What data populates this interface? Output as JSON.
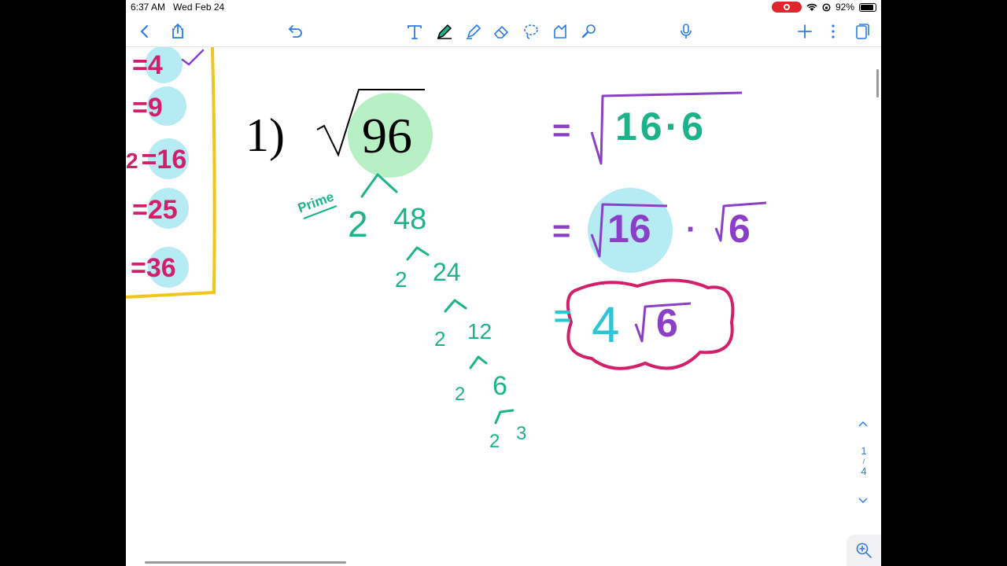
{
  "status": {
    "time": "6:37 AM",
    "date": "Wed Feb 24",
    "battery": "92%"
  },
  "toolbar": {
    "left": [
      "back-icon",
      "share-icon",
      "undo-icon"
    ],
    "tools": [
      "text-tool-icon",
      "pen-tool-icon",
      "highlighter-tool-icon",
      "eraser-tool-icon",
      "lasso-tool-icon",
      "shapes-tool-icon",
      "laser-pointer-icon"
    ],
    "right": [
      "microphone-icon",
      "add-icon",
      "more-icon",
      "pages-icon"
    ],
    "accent": "#2c7be5"
  },
  "perfect_squares": [
    {
      "value": "=4",
      "checked": true
    },
    {
      "value": "=9"
    },
    {
      "value": "=16",
      "prefix": "2"
    },
    {
      "value": "=25"
    },
    {
      "value": "=36"
    }
  ],
  "problem": {
    "number": "1)",
    "radicand": "96"
  },
  "prime_label": "Prime",
  "factor_tree": [
    {
      "left": "2",
      "right": "48"
    },
    {
      "left": "2",
      "right": "24"
    },
    {
      "left": "2",
      "right": "12"
    },
    {
      "left": "2",
      "right": "6"
    },
    {
      "left": "2",
      "right": "3"
    }
  ],
  "steps": {
    "step1_eq": "=",
    "step1": "16·6",
    "step2_eq": "=",
    "step2_a": "16",
    "step2_dot": "·",
    "step2_b": "6",
    "step3_eq": "=",
    "step3_coef": "4",
    "step3_rad": "6"
  },
  "page_indicator": {
    "current": "1",
    "sep": "/",
    "total": "4"
  },
  "colors": {
    "pink": "#d11f6b",
    "purple": "#8b3fc8",
    "green": "#1db38a",
    "cyan_highlight": "#b6ebf3",
    "green_highlight": "#b7f0c4",
    "yellow_box": "#f2c51c",
    "cyan_ink": "#2ec4d6"
  }
}
